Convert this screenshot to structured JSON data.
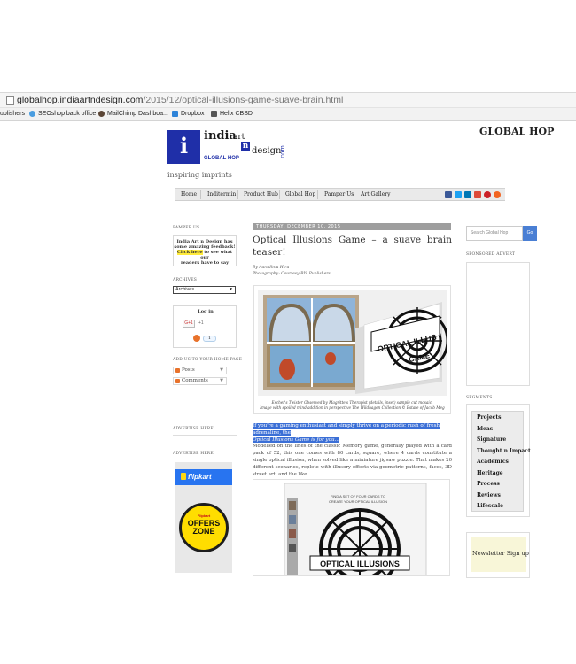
{
  "browser": {
    "url_domain": "globalhop.indiaartndesign.com",
    "url_path": "/2015/12/optical-illusions-game-suave-brain.html",
    "bookmarks": [
      "ublishers",
      "SEOshop back office",
      "MailChimp Dashboa...",
      "Dropbox",
      "Helix CBSD"
    ]
  },
  "header": {
    "logo_i": "i",
    "logo_india": "india",
    "logo_art": "art",
    "logo_n": "n",
    "logo_design": "design",
    "logo_dotcom": ".com",
    "logo_globalhop": "GLOBAL HOP",
    "site_title": "GLOBAL HOP",
    "tagline": "inspiring imprints"
  },
  "nav": {
    "items": [
      "Home",
      "Inditermin",
      "Product Hub",
      "Global Hop",
      "Pamper Us",
      "Art Gallery"
    ]
  },
  "left_sidebar": {
    "pamper_heading": "PAMPER US",
    "pamper_line1": "India Art n Design has",
    "pamper_line2": "some amazing feedback!",
    "pamper_click": "Click here",
    "pamper_line3": " to see what our",
    "pamper_line4": "readers have to say",
    "archives_heading": "ARCHIVES",
    "archives_value": "Archives",
    "login_label": "Log in",
    "gplus_label": "G+1",
    "gplus_count": "+1",
    "follow_count": "1",
    "add_heading": "ADD US TO YOUR HOME PAGE",
    "sub_posts": "Posts",
    "sub_comments": "Comments",
    "advertise1": "ADVERTISE HERE",
    "advertise2": "ADVERTISE HERE",
    "ad_flipkart": "flipkart",
    "ad_small": "Flipkart",
    "ad_offers": "OFFERS",
    "ad_zone": "ZONE"
  },
  "post": {
    "date": "THURSDAY, DECEMBER 10, 2015",
    "title_line1": "Optical Illusions Game – a suave brain",
    "title_line2": "teaser!",
    "byline1": "By Aaradhna Hiru",
    "byline2": "Photography: Courtesy BIS Publishers",
    "caption1_line1": "Escher's Twister Observed by Magritte's Therapist (details, inset) sample cut mosaic.",
    "caption1_line2": "Image with spoiled mind-addition in perspective The Wildhagen Collection © Estate of Jacob Meg",
    "box_text": "OPTICAL ILLUS GAME",
    "highlight_line1": "If you're a gaming enthusiast and simply thrive on a periodic rush of fresh adrenaline, the",
    "highlight_line2": "Optical Illusions Game is for you...",
    "body": "Modelled on the lines of the classic Memory game, generally played with a card pack of 52, this one comes with 80 cards, square, where 4 cards constitute a single optical illusion, when solved like a miniature jigsaw puzzle. That makes 20 different scenarios, replete with illusory effects via geometric patterns, faces, 3D street art, and the like.",
    "box2_top": "FIND A SET OF FOUR CARDS TO CREATE YOUR OPTICAL ILLUSION",
    "box2_title": "OPTICAL ILLUSIONS"
  },
  "right_sidebar": {
    "search_placeholder": "Search Global Hop",
    "search_button": "Go",
    "sponsored_heading": "SPONSORED ADVERT",
    "segments_heading": "SEGMENTS",
    "segments": [
      "Projects",
      "Ideas",
      "Signature",
      "Thought n Impact",
      "Academics",
      "Heritage",
      "Process",
      "Reviews",
      "Lifescale"
    ],
    "newsletter_label": "Newsletter Sign up"
  },
  "colors": {
    "logo_blue": "#1f2fa8",
    "highlight_blue": "#3b6fd6",
    "search_blue": "#4a7fd4",
    "flipkart_blue": "#2874f0",
    "offers_yellow": "#ffdd00"
  }
}
